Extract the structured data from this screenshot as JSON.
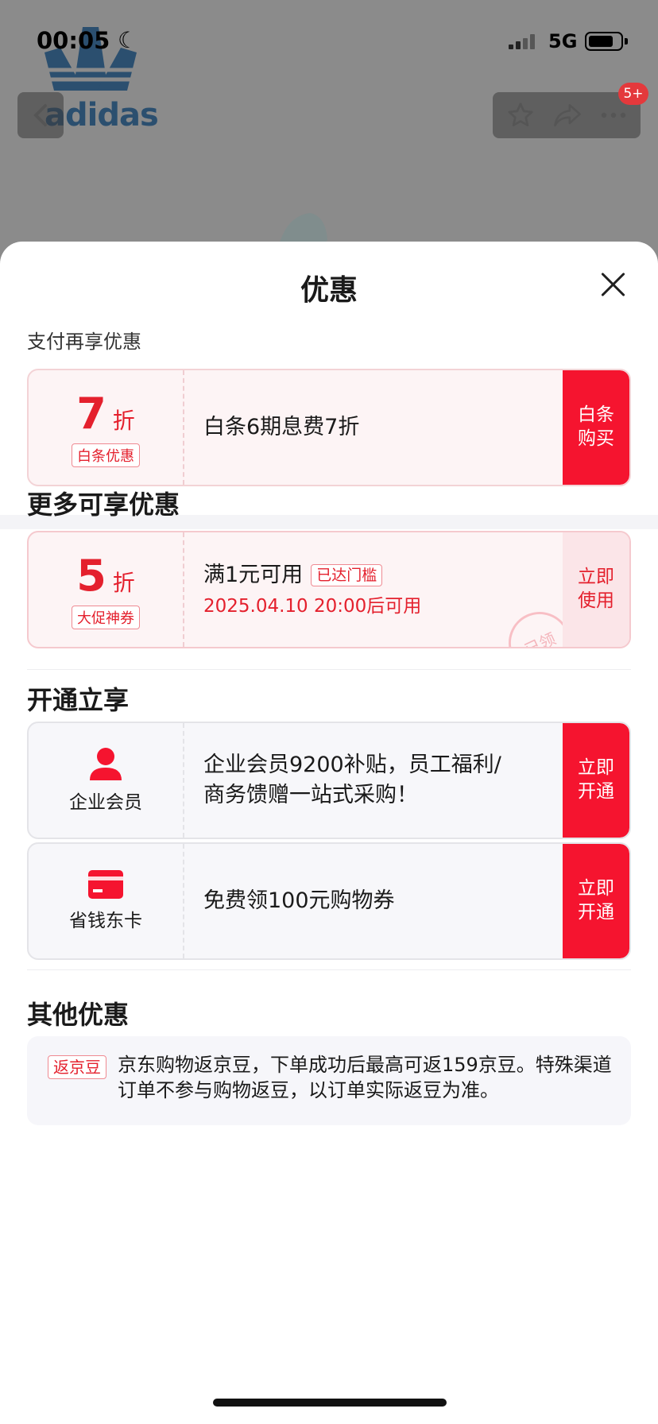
{
  "status_bar": {
    "time": "00:05",
    "network": "5G"
  },
  "background": {
    "brand_logo": "adidas",
    "cart_badge": "5+"
  },
  "sheet": {
    "title": "优惠",
    "pay_section": {
      "label": "支付再享优惠",
      "card": {
        "discount_num": "7",
        "discount_unit": "折",
        "tag": "白条优惠",
        "desc": "白条6期息费7折",
        "action": "白条\n购买"
      }
    },
    "more_section": {
      "title": "更多可享优惠",
      "card": {
        "discount_num": "5",
        "discount_unit": "折",
        "tag": "大促神券",
        "condition": "满1元可用",
        "condition_tag": "已达门槛",
        "valid": "2025.04.10 20:00后可用",
        "action": "立即\n使用",
        "stamp": "已领"
      }
    },
    "open_section": {
      "title": "开通立享",
      "items": [
        {
          "name": "企业会员",
          "icon": "person-icon",
          "desc": "企业会员9200补贴，员工福利/\n商务馈赠一站式采购！",
          "action": "立即\n开通"
        },
        {
          "name": "省钱东卡",
          "icon": "card-icon",
          "desc": "免费领100元购物券",
          "action": "立即\n开通"
        }
      ]
    },
    "other_section": {
      "title": "其他优惠",
      "tag": "返京豆",
      "text": "京东购物返京豆，下单成功后最高可返159京豆。特殊渠道订单不参与购物返豆，以订单实际返豆为准。"
    }
  },
  "colors": {
    "accent": "#f5142f",
    "accent_text": "#e4202d",
    "card_bg": "#fdf4f5"
  }
}
